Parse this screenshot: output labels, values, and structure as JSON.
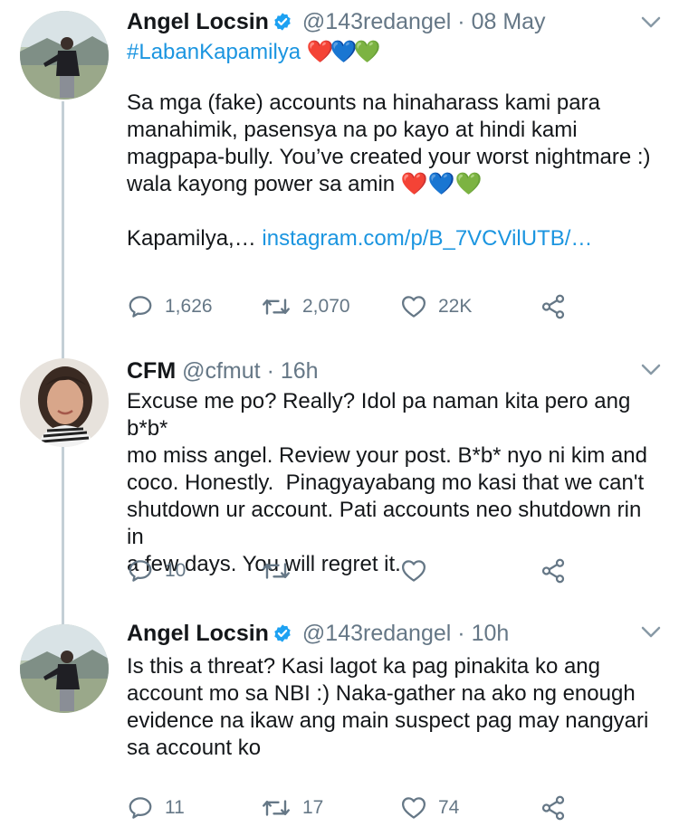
{
  "tweets": [
    {
      "name": "Angel Locsin",
      "handle": "@143redangel",
      "time": "08 May",
      "hashtag": "#LabanKapamilya",
      "hearts": "❤️💙💚",
      "text": "Sa mga (fake) accounts na hinaharass kami para\nmanahimik, pasensya na po kayo at hindi kami\nmagpapa-bully. You’ve created your worst nightmare :)\nwala kayong power sa amin ❤️💙💚\n\nKapamilya,… ",
      "link": "instagram.com/p/B_7VCVilUTB/…",
      "replies": "1,626",
      "retweets": "2,070",
      "likes": "22K"
    },
    {
      "name": "CFM",
      "handle": "@cfmut",
      "time": "16h",
      "text": "Excuse me po? Really? Idol pa naman kita pero ang b*b*\nmo miss angel. Review your post. B*b* nyo ni kim and\ncoco. Honestly.  Pinagyayabang mo kasi that we can't\nshutdown ur account. Pati accounts neo shutdown rin in\na few days. You will regret it.",
      "replies": "10",
      "retweets": "",
      "likes": ""
    },
    {
      "name": "Angel Locsin",
      "handle": "@143redangel",
      "time": "10h",
      "text": "Is this a threat? Kasi lagot ka pag pinakita ko ang\naccount mo sa NBI :) Naka-gather na ako ng enough\nevidence na ikaw ang main suspect pag may nangyari\nsa account ko",
      "replies": "11",
      "retweets": "17",
      "likes": "74"
    }
  ],
  "separator": "·",
  "colors": {
    "link": "#1b95e0",
    "secondary": "#657786",
    "thread_line": "#c4cfd6",
    "verified": "#1da1f2"
  },
  "icons": [
    "verified-badge-icon",
    "chevron-down-icon",
    "reply-icon",
    "retweet-icon",
    "like-icon",
    "share-icon"
  ]
}
